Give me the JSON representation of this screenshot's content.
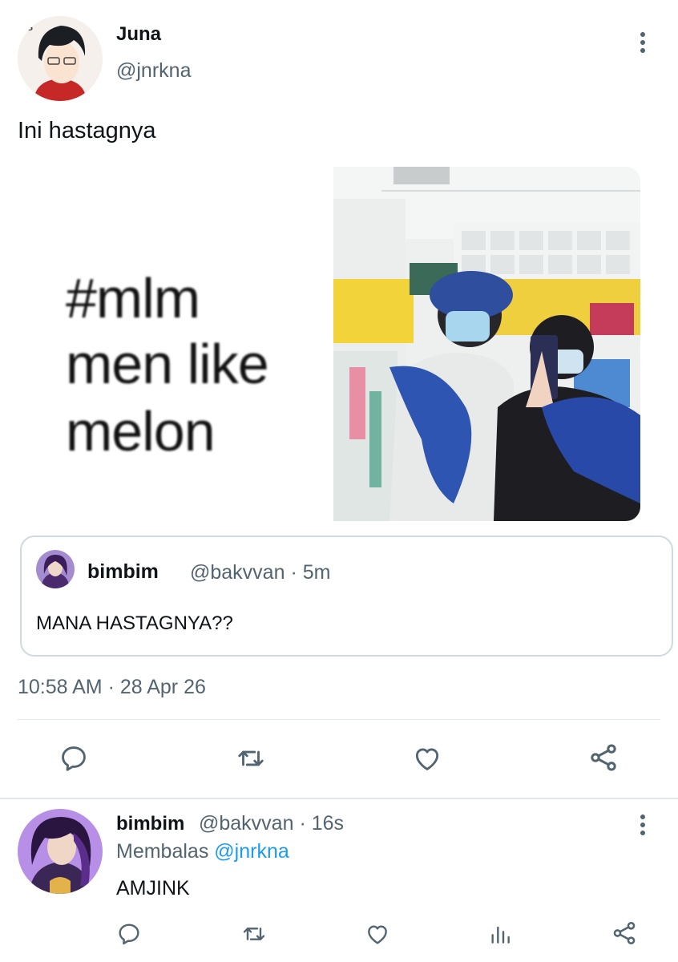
{
  "main_tweet": {
    "author_name": "Juna",
    "author_handle": "@jnrkna",
    "text": "Ini hastagnya",
    "media": {
      "meme_lines": [
        "#mlm",
        "men like",
        "melon"
      ]
    },
    "quote": {
      "author_name": "bimbim",
      "meta": "@bakvvan · 5m",
      "text": "MANA HASTAGNYA??"
    },
    "timestamp": "10:58 AM · 28 Apr 26",
    "actions": [
      "reply-icon",
      "retweet-icon",
      "like-icon",
      "share-icon"
    ]
  },
  "reply_tweet": {
    "author_name": "bimbim",
    "meta": "@bakvvan · 16s",
    "replying_prefix": "Membalas",
    "replying_to": "@jnrkna",
    "text": "AMJINK",
    "actions": [
      "reply-icon",
      "retweet-icon",
      "like-icon",
      "views-icon",
      "share-icon"
    ]
  },
  "colors": {
    "text": "#0f1419",
    "secondary": "#536471",
    "link": "#1d9bf0",
    "border": "#cfd9de"
  }
}
